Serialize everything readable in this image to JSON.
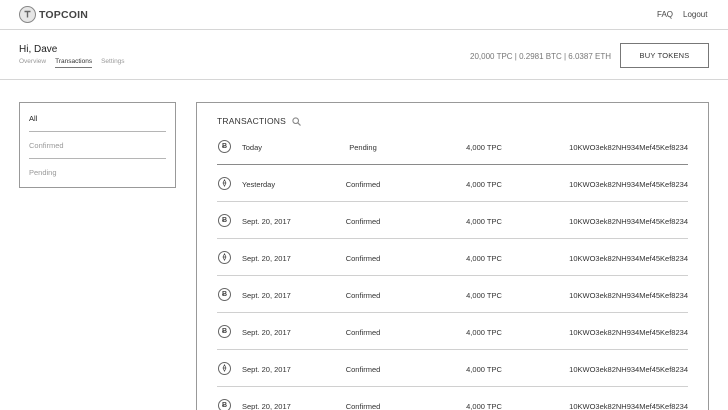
{
  "brand": {
    "name": "TOPCOIN"
  },
  "topnav": {
    "faq": "FAQ",
    "logout": "Logout"
  },
  "header": {
    "greeting": "Hi, Dave",
    "tabs": [
      "Overview",
      "Transactions",
      "Settings"
    ],
    "active_tab": "Transactions",
    "balance": "20,000 TPC | 0.2981 BTC | 6.0387 ETH",
    "buy_label": "BUY TOKENS"
  },
  "filters": {
    "items": [
      "All",
      "Confirmed",
      "Pending"
    ],
    "active": "All"
  },
  "transactions": {
    "title": "TRANSACTIONS",
    "rows": [
      {
        "coin": "btc",
        "date": "Today",
        "status": "Pending",
        "amount": "4,000 TPC",
        "hash": "10KWO3ek82NH934Mef45Kef8234"
      },
      {
        "coin": "eth",
        "date": "Yesterday",
        "status": "Confirmed",
        "amount": "4,000 TPC",
        "hash": "10KWO3ek82NH934Mef45Kef8234"
      },
      {
        "coin": "btc",
        "date": "Sept. 20, 2017",
        "status": "Confirmed",
        "amount": "4,000 TPC",
        "hash": "10KWO3ek82NH934Mef45Kef8234"
      },
      {
        "coin": "eth",
        "date": "Sept. 20, 2017",
        "status": "Confirmed",
        "amount": "4,000 TPC",
        "hash": "10KWO3ek82NH934Mef45Kef8234"
      },
      {
        "coin": "btc",
        "date": "Sept. 20, 2017",
        "status": "Confirmed",
        "amount": "4,000 TPC",
        "hash": "10KWO3ek82NH934Mef45Kef8234"
      },
      {
        "coin": "btc",
        "date": "Sept. 20, 2017",
        "status": "Confirmed",
        "amount": "4,000 TPC",
        "hash": "10KWO3ek82NH934Mef45Kef8234"
      },
      {
        "coin": "eth",
        "date": "Sept. 20, 2017",
        "status": "Confirmed",
        "amount": "4,000 TPC",
        "hash": "10KWO3ek82NH934Mef45Kef8234"
      },
      {
        "coin": "btc",
        "date": "Sept. 20, 2017",
        "status": "Confirmed",
        "amount": "4,000 TPC",
        "hash": "10KWO3ek82NH934Mef45Kef8234"
      }
    ]
  }
}
